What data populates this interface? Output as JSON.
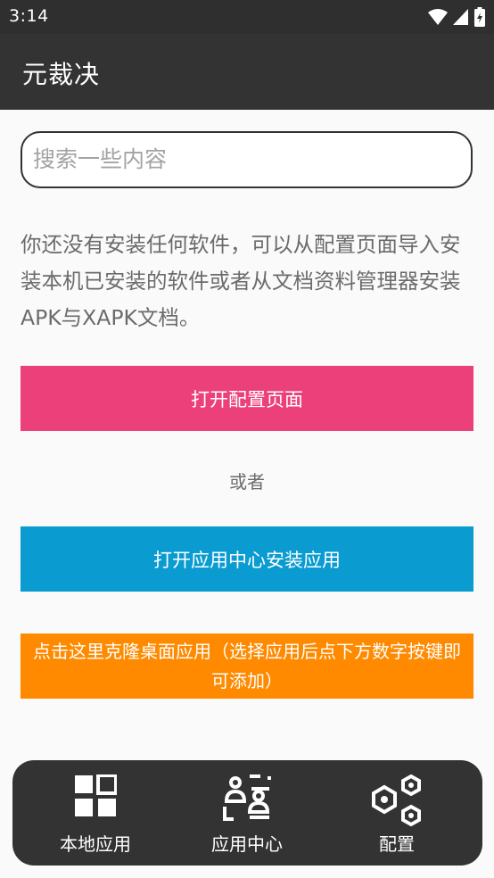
{
  "status_bar": {
    "time": "3:14",
    "icons": [
      "wifi-icon",
      "signal-icon",
      "battery-icon"
    ]
  },
  "app_bar": {
    "title": "元裁决"
  },
  "search": {
    "placeholder": "搜索一些内容",
    "value": ""
  },
  "empty_state": {
    "message": "你还没有安装任何软件，可以从配置页面导入安装本机已安装的软件或者从文档资料管理器安装APK与XAPK文档。",
    "open_config_label": "打开配置页面",
    "or_label": "或者",
    "open_appcenter_label": "打开应用中心安装应用",
    "clone_label": "点击这里克隆桌面应用（选择应用后点下方数字按键即可添加）"
  },
  "bottom_nav": {
    "items": [
      {
        "label": "本地应用",
        "icon": "grid-icon"
      },
      {
        "label": "应用中心",
        "icon": "app-center-icon"
      },
      {
        "label": "配置",
        "icon": "hexagons-icon"
      }
    ]
  },
  "colors": {
    "appbar": "#333333",
    "pink_button": "#ec407a",
    "blue_button": "#0a9bd1",
    "orange_button": "#ff8a00"
  }
}
